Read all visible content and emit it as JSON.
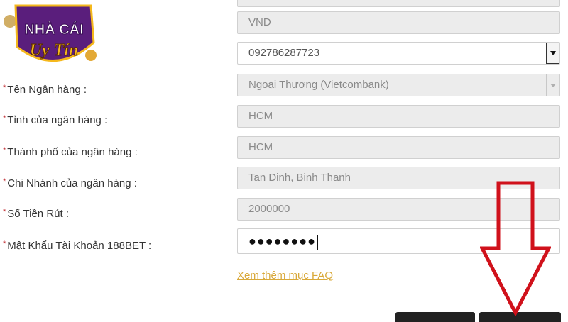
{
  "form": {
    "rows": [
      {
        "label": "",
        "value": "VND",
        "style": "grey",
        "control": "none"
      },
      {
        "label": "",
        "value": "092786287723",
        "style": "white",
        "control": "select-dark"
      },
      {
        "label": "Tên Ngân hàng :",
        "value": "Ngoại Thương (Vietcombank)",
        "style": "grey",
        "control": "select-light"
      },
      {
        "label": "Tỉnh của ngân hàng :",
        "value": "HCM",
        "style": "grey",
        "control": "none"
      },
      {
        "label": "Thành phố của ngân hàng :",
        "value": "HCM",
        "style": "grey",
        "control": "none"
      },
      {
        "label": "Chi Nhánh của ngân hàng :",
        "value": "Tan Dinh, Binh Thanh",
        "style": "grey",
        "control": "none"
      },
      {
        "label": "Số Tiền Rút :",
        "value": "2000000",
        "style": "grey",
        "control": "none"
      },
      {
        "label": "Mật Khẩu Tài Khoản 188BET :",
        "value": "●●●●●●●●",
        "style": "white",
        "control": "password"
      }
    ],
    "required_mark": "*",
    "faq_link": "Xem thêm mục FAQ"
  },
  "logo": {
    "line1": "NHÀ CÁI",
    "line2": "Uy Tín"
  },
  "colors": {
    "required": "#c0282d",
    "faq_link": "#d9a93a",
    "arrow": "#d0111b",
    "logo_purple": "#5a1e7c",
    "logo_gold": "#f5b81c"
  },
  "icons": {
    "annotation": "down-arrow-icon",
    "dropdown": "chevron-down-icon"
  }
}
